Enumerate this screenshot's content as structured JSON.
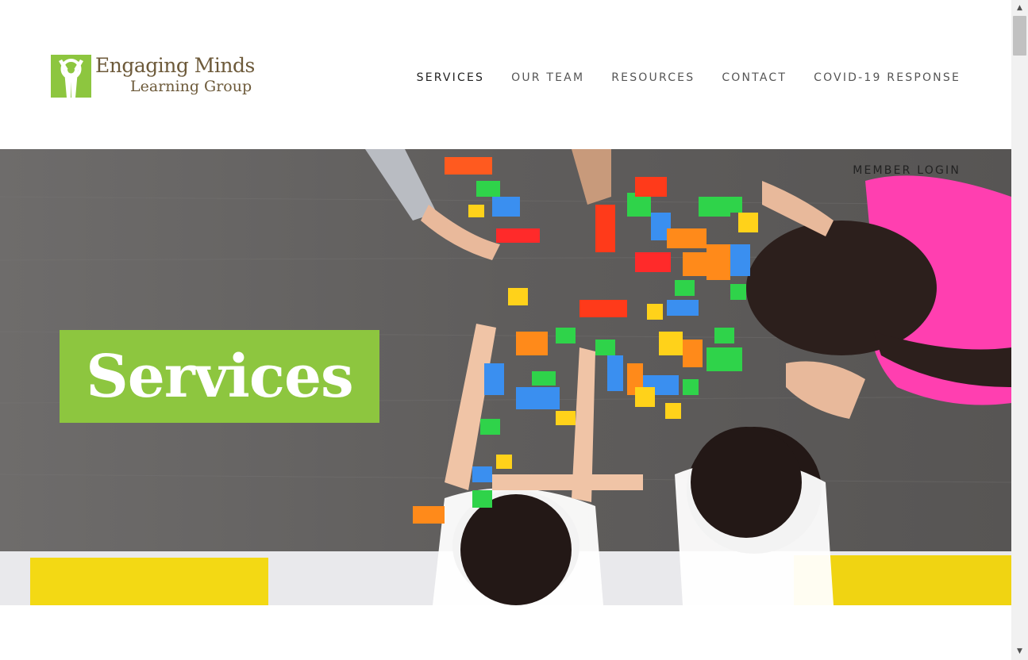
{
  "logo": {
    "name_line1": "Engaging Minds",
    "name_line2": "Learning Group",
    "brand_color": "#8dc63f",
    "text_color": "#6d5a3a"
  },
  "nav": {
    "items": [
      {
        "label": "SERVICES",
        "active": true
      },
      {
        "label": "OUR TEAM",
        "active": false
      },
      {
        "label": "RESOURCES",
        "active": false
      },
      {
        "label": "CONTACT",
        "active": false
      },
      {
        "label": "COVID-19 RESPONSE",
        "active": false
      }
    ]
  },
  "hero": {
    "member_login": "MEMBER LOGIN",
    "title": "Services",
    "title_box_color": "#8dc63f"
  }
}
